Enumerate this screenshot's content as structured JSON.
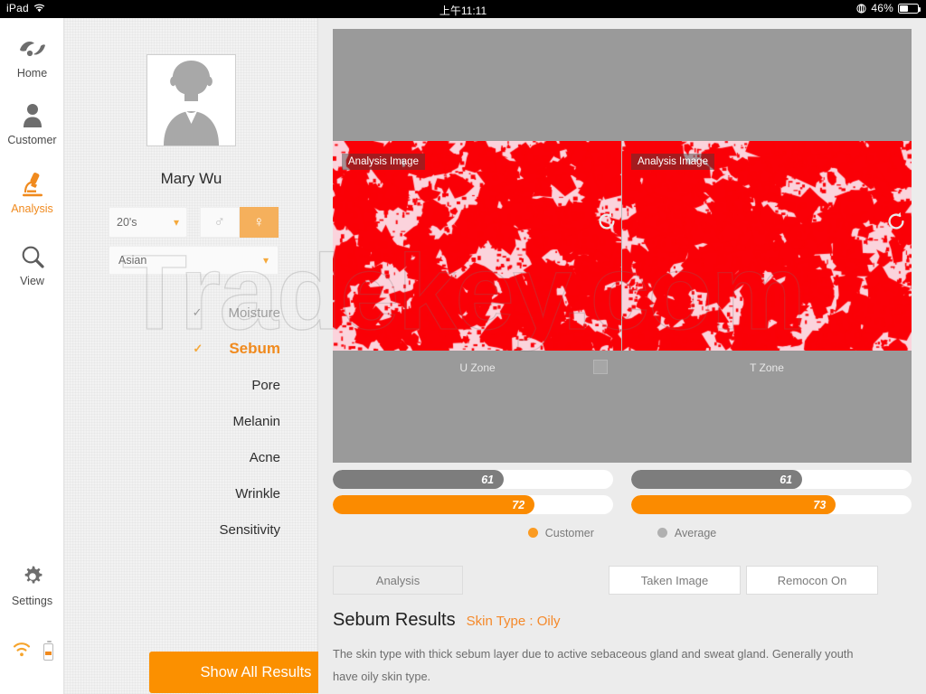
{
  "statusbar": {
    "device": "iPad",
    "wifi_icon": "wifi-icon",
    "time": "上午11:11",
    "location_icon": "location-icon",
    "battery_percent": "46%",
    "battery_icon": "battery-icon"
  },
  "sidebar": {
    "items": [
      {
        "key": "home",
        "label": "Home",
        "icon": "home-leaf-icon",
        "active": false
      },
      {
        "key": "customer",
        "label": "Customer",
        "icon": "person-icon",
        "active": false
      },
      {
        "key": "analysis",
        "label": "Analysis",
        "icon": "microscope-icon",
        "active": true
      },
      {
        "key": "view",
        "label": "View",
        "icon": "magnifier-icon",
        "active": false
      },
      {
        "key": "settings",
        "label": "Settings",
        "icon": "gear-icon",
        "active": false
      }
    ],
    "status_icons": [
      "wifi-icon",
      "battery-icon"
    ],
    "accent_color": "#f08a1e"
  },
  "customer": {
    "avatar_icon": "person-placeholder-avatar",
    "name": "Mary  Wu",
    "age_select": {
      "value": "20's",
      "chevron": "chevron-down-icon"
    },
    "gender": {
      "male_symbol": "♂",
      "female_symbol": "♀",
      "selected": "female"
    },
    "ethnicity_select": {
      "value": "Asian",
      "chevron": "chevron-down-icon"
    }
  },
  "menu": {
    "items": [
      {
        "label": "Moisture",
        "state": "done",
        "checked": true
      },
      {
        "label": "Sebum",
        "state": "active",
        "checked": true
      },
      {
        "label": "Pore",
        "state": "normal",
        "checked": false
      },
      {
        "label": "Melanin",
        "state": "normal",
        "checked": false
      },
      {
        "label": "Acne",
        "state": "normal",
        "checked": false
      },
      {
        "label": "Wrinkle",
        "state": "normal",
        "checked": false
      },
      {
        "label": "Sensitivity",
        "state": "normal",
        "checked": false
      }
    ],
    "check_glyph": "✓"
  },
  "show_all_button": {
    "label": "Show All Results"
  },
  "analysis_images": {
    "left": {
      "tag": "Analysis Image",
      "zone": "U Zone",
      "rotate_icon": "rotate-ccw-icon",
      "checkbox": "selection-checkbox"
    },
    "right": {
      "tag": "Analysis Image",
      "zone": "T Zone",
      "rotate_icon": "rotate-ccw-icon"
    }
  },
  "chart_data": {
    "type": "bar",
    "title": "Sebum Results",
    "orientation": "horizontal",
    "categories": [
      "U Zone",
      "T Zone"
    ],
    "series": [
      {
        "name": "Average",
        "color": "#7d7d7d",
        "values": [
          61,
          61
        ]
      },
      {
        "name": "Customer",
        "color": "#fb8b00",
        "values": [
          72,
          73
        ]
      }
    ],
    "xlim": [
      0,
      100
    ],
    "grid": false,
    "legend": [
      "Customer",
      "Average"
    ],
    "legend_position": "bottom"
  },
  "legend": {
    "customer_label": "Customer",
    "average_label": "Average",
    "customer_color": "#fb9b22",
    "average_color": "#b0b0b0"
  },
  "actions": [
    {
      "key": "analysis",
      "label": "Analysis"
    },
    {
      "key": "taken-image",
      "label": "Taken Image"
    },
    {
      "key": "remocon",
      "label": "Remocon On"
    }
  ],
  "results": {
    "title": "Sebum Results",
    "skin_type": "Skin Type : Oily",
    "description": "The skin type with thick sebum layer due to active sebaceous gland and sweat gland. Generally youth have oily skin type."
  },
  "watermark": {
    "text": "Tradekey.com"
  },
  "assistive_touch": {
    "icon": "assistive-touch-icon"
  }
}
